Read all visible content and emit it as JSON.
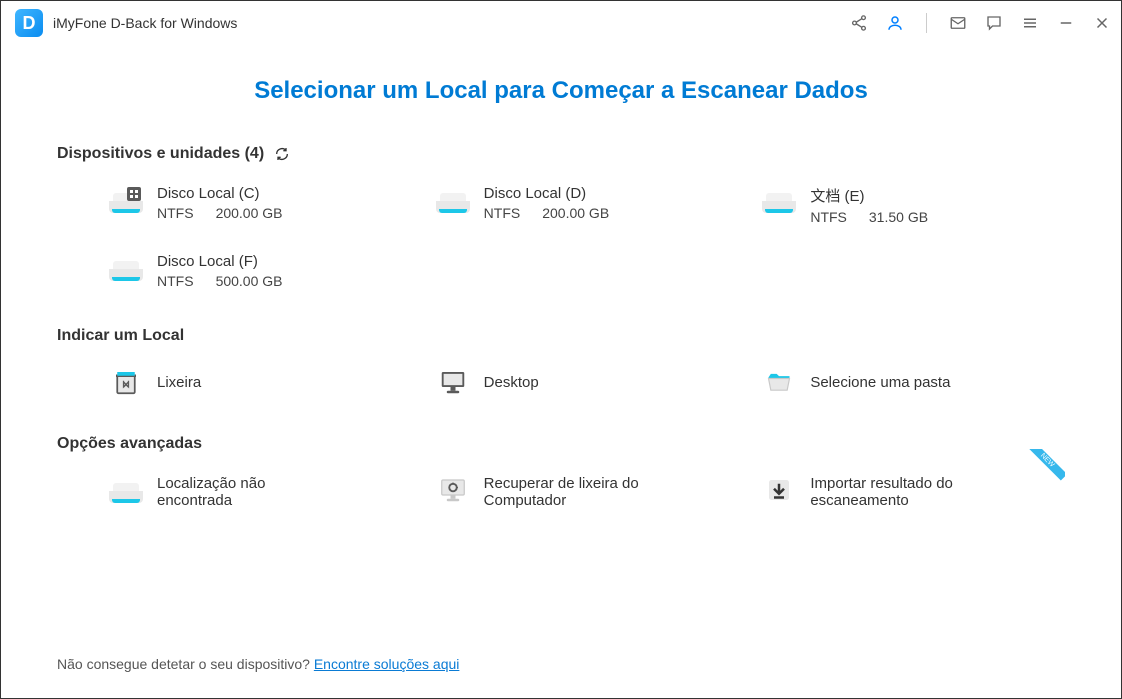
{
  "app": {
    "title": "iMyFone D-Back for Windows",
    "logo_letter": "D"
  },
  "heading": "Selecionar um Local para Começar a Escanear Dados",
  "sections": {
    "devices": {
      "title": "Dispositivos e unidades (4)"
    },
    "location": {
      "title": "Indicar um Local"
    },
    "advanced": {
      "title": "Opções avançadas"
    }
  },
  "drives": [
    {
      "name": "Disco Local (C)",
      "fs": "NTFS",
      "size": "200.00 GB",
      "is_os": true
    },
    {
      "name": "Disco Local (D)",
      "fs": "NTFS",
      "size": "200.00 GB",
      "is_os": false
    },
    {
      "name": "文档 (E)",
      "fs": "NTFS",
      "size": "31.50 GB",
      "is_os": false
    },
    {
      "name": "Disco Local (F)",
      "fs": "NTFS",
      "size": "500.00 GB",
      "is_os": false
    }
  ],
  "locations": {
    "recycle_bin": "Lixeira",
    "desktop": "Desktop",
    "select_folder": "Selecione uma pasta"
  },
  "advanced": {
    "not_found": "Localização não encontrada",
    "recover_bin": "Recuperar de lixeira do Computador",
    "import_scan": "Importar resultado do escaneamento"
  },
  "footer": {
    "text": "Não consegue detetar o seu dispositivo? ",
    "link": "Encontre soluções aqui"
  },
  "new_badge": "NEW"
}
